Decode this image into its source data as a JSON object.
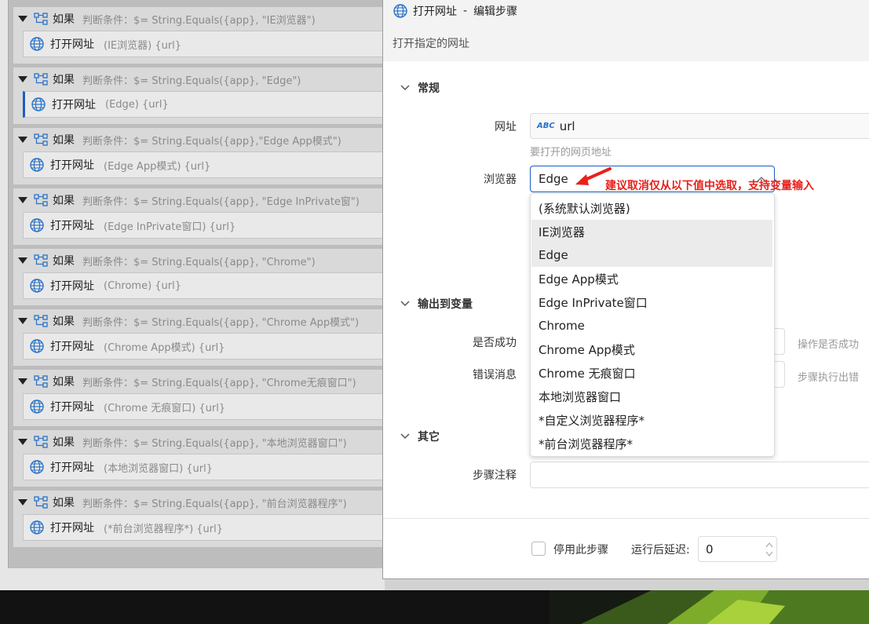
{
  "left_panel": {
    "groups": [
      {
        "if_label": "如果",
        "condition": "判断条件：$= String.Equals({app}, \"IE浏览器\")",
        "step_title": "打开网址",
        "step_params": "(IE浏览器) {url}",
        "selected": false
      },
      {
        "if_label": "如果",
        "condition": "判断条件：$= String.Equals({app}, \"Edge\")",
        "step_title": "打开网址",
        "step_params": "(Edge) {url}",
        "selected": true
      },
      {
        "if_label": "如果",
        "condition": "判断条件：$= String.Equals({app},\"Edge App模式\")",
        "step_title": "打开网址",
        "step_params": "(Edge App模式) {url}",
        "selected": false
      },
      {
        "if_label": "如果",
        "condition": "判断条件：$= String.Equals({app}, \"Edge InPrivate窗\")",
        "step_title": "打开网址",
        "step_params": "(Edge InPrivate窗口) {url}",
        "selected": false
      },
      {
        "if_label": "如果",
        "condition": "判断条件：$= String.Equals({app}, \"Chrome\")",
        "step_title": "打开网址",
        "step_params": "(Chrome) {url}",
        "selected": false
      },
      {
        "if_label": "如果",
        "condition": "判断条件：$= String.Equals({app}, \"Chrome App模式\")",
        "step_title": "打开网址",
        "step_params": "(Chrome App模式) {url}",
        "selected": false
      },
      {
        "if_label": "如果",
        "condition": "判断条件：$= String.Equals({app}, \"Chrome无痕窗口\")",
        "step_title": "打开网址",
        "step_params": "(Chrome 无痕窗口) {url}",
        "selected": false
      },
      {
        "if_label": "如果",
        "condition": "判断条件：$= String.Equals({app}, \"本地浏览器窗口\")",
        "step_title": "打开网址",
        "step_params": "(本地浏览器窗口) {url}",
        "selected": false
      },
      {
        "if_label": "如果",
        "condition": "判断条件：$= String.Equals({app}, \"前台浏览器程序\")",
        "step_title": "打开网址",
        "step_params": "(*前台浏览器程序*) {url}",
        "selected": false
      }
    ]
  },
  "dialog": {
    "title_step": "打开网址",
    "title_sep": "-",
    "title_action": "编辑步骤",
    "description": "打开指定的网址",
    "sections": {
      "general": "常规",
      "output": "输出到变量",
      "other": "其它"
    },
    "fields": {
      "url_label": "网址",
      "url_type_badge": "ABC",
      "url_value": "url",
      "url_hint": "要打开的网页地址",
      "browser_label": "浏览器",
      "browser_value": "Edge",
      "success_label": "是否成功",
      "success_hint": "操作是否成功",
      "error_label": "错误消息",
      "error_hint": "步骤执行出错",
      "comment_label": "步骤注释"
    },
    "browser_options": [
      "(系统默认浏览器)",
      "IE浏览器",
      "Edge",
      "Edge App模式",
      "Edge InPrivate窗口",
      "Chrome",
      "Chrome App模式",
      "Chrome 无痕窗口",
      "本地浏览器窗口",
      "*自定义浏览器程序*",
      "*前台浏览器程序*"
    ],
    "annotation": "建议取消仅从以下值中选取，支持变量输入",
    "footer": {
      "disable_label": "停用此步骤",
      "delay_label": "运行后延迟:",
      "delay_value": "0"
    }
  },
  "colors": {
    "accent": "#1a5fc2",
    "annotation": "#e8211c",
    "icon_blue": "#2a72c7"
  }
}
